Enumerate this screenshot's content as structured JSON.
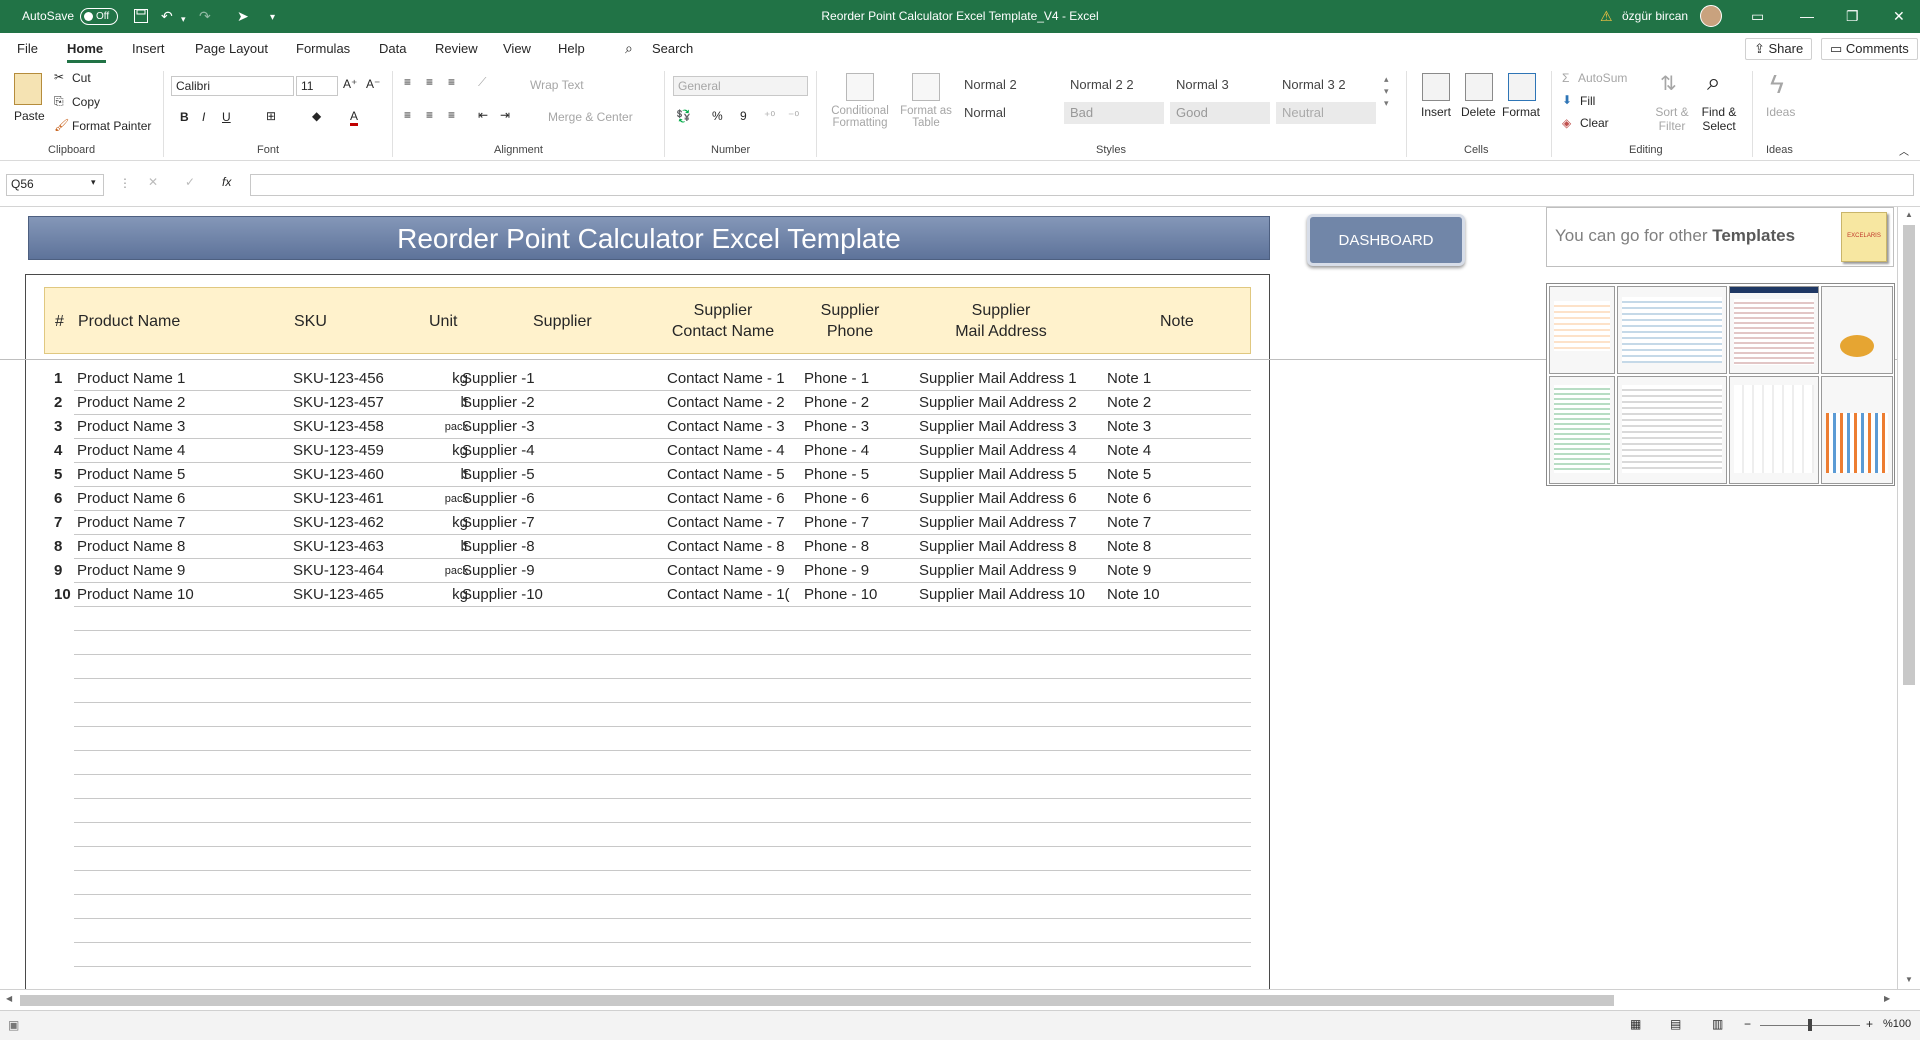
{
  "titlebar": {
    "autosave_label": "AutoSave",
    "autosave_state": "Off",
    "document_title": "Reorder Point Calculator Excel Template_V4  -  Excel",
    "user_name": "özgür bircan",
    "accent_color": "#217346"
  },
  "tabs": [
    "File",
    "Home",
    "Insert",
    "Page Layout",
    "Formulas",
    "Data",
    "Review",
    "View",
    "Help"
  ],
  "active_tab": "Home",
  "search_label": "Search",
  "share_label": "Share",
  "comments_label": "Comments",
  "ribbon": {
    "clipboard": {
      "paste": "Paste",
      "cut": "Cut",
      "copy": "Copy",
      "format_painter": "Format Painter",
      "label": "Clipboard"
    },
    "font": {
      "name": "Calibri",
      "size": "11",
      "bold": "B",
      "italic": "I",
      "underline": "U",
      "label": "Font"
    },
    "alignment": {
      "wrap_text": "Wrap Text",
      "merge_center": "Merge & Center",
      "label": "Alignment"
    },
    "number": {
      "format": "General",
      "label": "Number"
    },
    "styles": {
      "conditional": "Conditional Formatting",
      "format_as_table": "Format as Table",
      "cells": [
        "Normal 2",
        "Normal 2 2",
        "Normal 3",
        "Normal 3 2",
        "Normal",
        "Bad",
        "Good",
        "Neutral"
      ],
      "label": "Styles"
    },
    "cells": {
      "insert": "Insert",
      "delete": "Delete",
      "format": "Format",
      "label": "Cells"
    },
    "editing": {
      "autosum": "AutoSum",
      "fill": "Fill",
      "clear": "Clear",
      "sort_filter": "Sort & Filter",
      "find_select": "Find & Select",
      "label": "Editing"
    },
    "ideas": {
      "ideas": "Ideas",
      "label": "Ideas"
    }
  },
  "formula_bar": {
    "name_box": "Q56",
    "fx": "fx",
    "content": ""
  },
  "sheet": {
    "banner_title": "Reorder Point Calculator Excel Template",
    "dashboard_button": "DASHBOARD",
    "promo_text_pre": "You can go for other ",
    "promo_text_bold": "Templates",
    "promo_logo": "EXCELARIS",
    "headers": {
      "num": "#",
      "product": "Product Name",
      "sku": "SKU",
      "unit": "Unit",
      "supplier": "Supplier",
      "contact_l1": "Supplier",
      "contact_l2": "Contact Name",
      "phone_l1": "Supplier",
      "phone_l2": "Phone",
      "mail_l1": "Supplier",
      "mail_l2": "Mail Address",
      "note": "Note"
    },
    "rows": [
      {
        "num": "1",
        "product": "Product Name 1",
        "sku": "SKU-123-456",
        "unit": "kg",
        "supplier": "Supplier -1",
        "contact": "Contact Name - 1",
        "phone": "Phone - 1",
        "mail": "Supplier Mail Address 1",
        "note": "Note 1"
      },
      {
        "num": "2",
        "product": "Product Name 2",
        "sku": "SKU-123-457",
        "unit": "lt",
        "supplier": "Supplier -2",
        "contact": "Contact Name - 2",
        "phone": "Phone - 2",
        "mail": "Supplier Mail Address 2",
        "note": "Note 2"
      },
      {
        "num": "3",
        "product": "Product Name 3",
        "sku": "SKU-123-458",
        "unit": "pack",
        "supplier": "Supplier -3",
        "contact": "Contact Name - 3",
        "phone": "Phone - 3",
        "mail": "Supplier Mail Address 3",
        "note": "Note 3"
      },
      {
        "num": "4",
        "product": "Product Name 4",
        "sku": "SKU-123-459",
        "unit": "kg",
        "supplier": "Supplier -4",
        "contact": "Contact Name - 4",
        "phone": "Phone - 4",
        "mail": "Supplier Mail Address 4",
        "note": "Note 4"
      },
      {
        "num": "5",
        "product": "Product Name 5",
        "sku": "SKU-123-460",
        "unit": "lt",
        "supplier": "Supplier -5",
        "contact": "Contact Name - 5",
        "phone": "Phone - 5",
        "mail": "Supplier Mail Address 5",
        "note": "Note 5"
      },
      {
        "num": "6",
        "product": "Product Name 6",
        "sku": "SKU-123-461",
        "unit": "pack",
        "supplier": "Supplier -6",
        "contact": "Contact Name - 6",
        "phone": "Phone - 6",
        "mail": "Supplier Mail Address 6",
        "note": "Note 6"
      },
      {
        "num": "7",
        "product": "Product Name 7",
        "sku": "SKU-123-462",
        "unit": "kg",
        "supplier": "Supplier -7",
        "contact": "Contact Name - 7",
        "phone": "Phone - 7",
        "mail": "Supplier Mail Address 7",
        "note": "Note 7"
      },
      {
        "num": "8",
        "product": "Product Name 8",
        "sku": "SKU-123-463",
        "unit": "lt",
        "supplier": "Supplier -8",
        "contact": "Contact Name - 8",
        "phone": "Phone - 8",
        "mail": "Supplier Mail Address 8",
        "note": "Note 8"
      },
      {
        "num": "9",
        "product": "Product Name 9",
        "sku": "SKU-123-464",
        "unit": "pack",
        "supplier": "Supplier -9",
        "contact": "Contact Name - 9",
        "phone": "Phone - 9",
        "mail": "Supplier Mail Address 9",
        "note": "Note 9"
      },
      {
        "num": "10",
        "product": "Product Name 10",
        "sku": "SKU-123-465",
        "unit": "kg",
        "supplier": "Supplier -10",
        "contact": "Contact Name - 1(",
        "phone": "Phone - 10",
        "mail": "Supplier Mail Address 10",
        "note": "Note 10"
      }
    ]
  },
  "status": {
    "zoom": "%100"
  }
}
